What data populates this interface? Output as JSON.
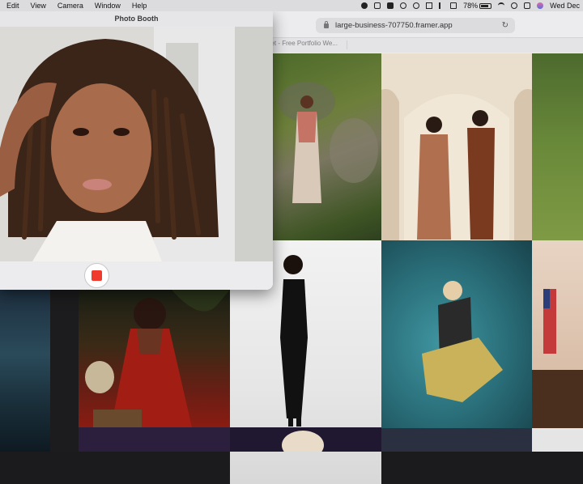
{
  "menubar": {
    "items": [
      "Edit",
      "View",
      "Camera",
      "Window",
      "Help"
    ],
    "battery": "78%",
    "clock": "Wed Dec"
  },
  "browser": {
    "url": "large-business-707750.framer.app",
    "tab_title": "het - Free Portfolio We..."
  },
  "photo_booth": {
    "title": "Photo Booth"
  },
  "colors": {
    "record": "#f03a2e",
    "menubar": "#dcdcdf"
  }
}
